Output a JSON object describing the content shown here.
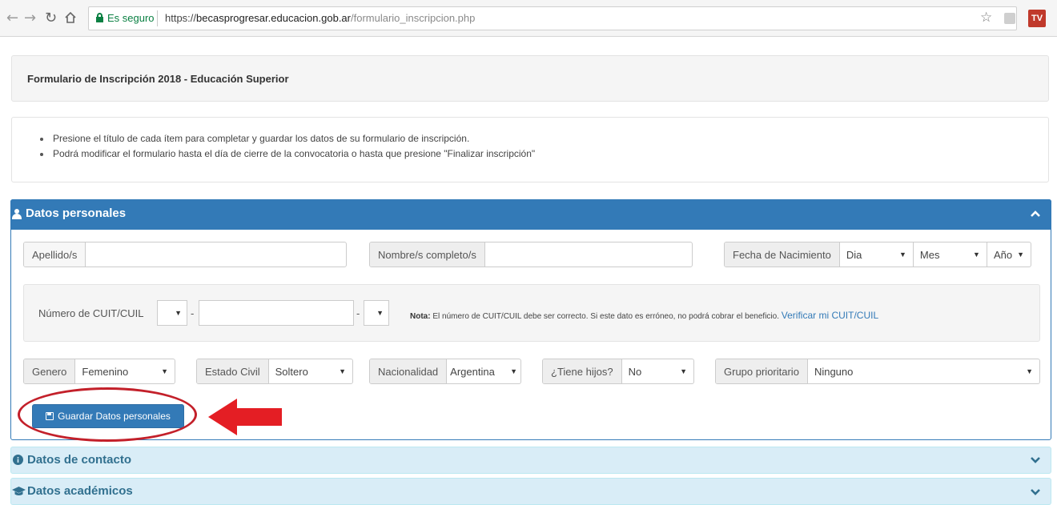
{
  "browser": {
    "secure_label": "Es seguro",
    "url_scheme": "https://",
    "url_domain": "becasprogresar.educacion.gob.ar",
    "url_path": "/formulario_inscripcion.php",
    "extension_label": "TV"
  },
  "page": {
    "title": "Formulario de Inscripción 2018 - Educación Superior",
    "info_items": [
      "Presione el título de cada ítem para completar y guardar los datos de su formulario de inscripción.",
      "Podrá modificar el formulario hasta el día de cierre de la convocatoria o hasta que presione \"Finalizar inscripción\""
    ]
  },
  "personal_panel": {
    "title": "Datos personales",
    "apellido_label": "Apellido/s",
    "nombre_label": "Nombre/s completo/s",
    "fecha_label": "Fecha de Nacimiento",
    "dia": "Dia",
    "mes": "Mes",
    "anio": "Año",
    "cuit_label": "Número de CUIT/CUIL",
    "cuit_dash": "-",
    "nota_bold": "Nota:",
    "nota_text": " El número de CUIT/CUIL debe ser correcto. Si este dato es erróneo, no podrá cobrar el beneficio.",
    "verify_link": "Verificar mi CUIT/CUIL",
    "genero_label": "Genero",
    "genero_value": "Femenino",
    "estado_label": "Estado Civil",
    "estado_value": "Soltero",
    "nacionalidad_label": "Nacionalidad",
    "nacionalidad_value": "Argentina",
    "hijos_label": "¿Tiene hijos?",
    "hijos_value": "No",
    "grupo_label": "Grupo prioritario",
    "grupo_value": "Ninguno",
    "save_button": "Guardar Datos personales"
  },
  "contact_panel": {
    "title": "Datos de contacto"
  },
  "academic_panel": {
    "title": "Datos académicos"
  },
  "colors": {
    "primary": "#337ab7",
    "info_bg": "#d9edf7",
    "info_text": "#31708f",
    "annotation_red": "#c3202a"
  }
}
